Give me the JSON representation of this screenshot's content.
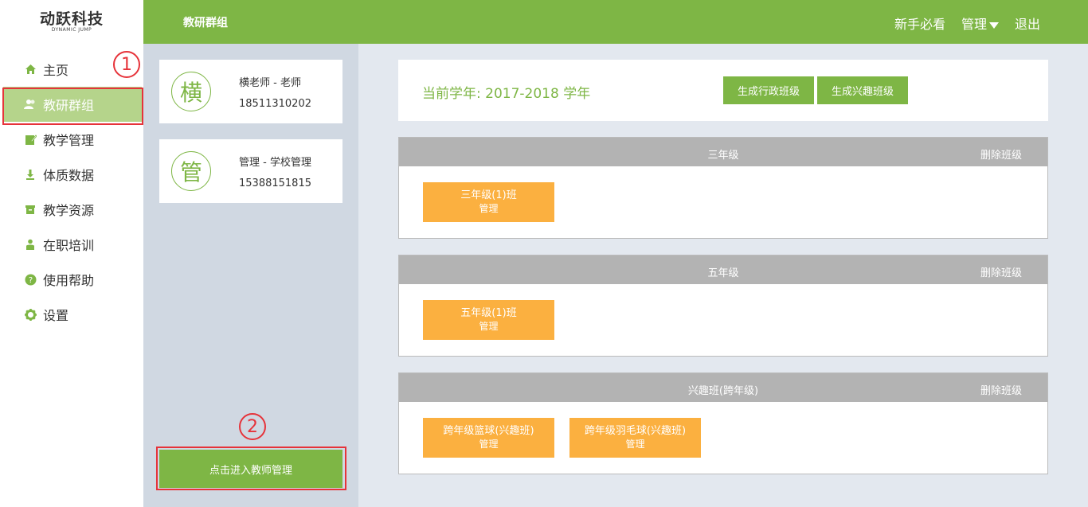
{
  "logo": {
    "main": "动跃科技",
    "sub": "DYNAMIC JUMP"
  },
  "sidebar": {
    "items": [
      {
        "label": "主页",
        "icon": "home-icon"
      },
      {
        "label": "教研群组",
        "icon": "users-icon"
      },
      {
        "label": "教学管理",
        "icon": "edit-icon"
      },
      {
        "label": "体质数据",
        "icon": "download-icon"
      },
      {
        "label": "教学资源",
        "icon": "box-icon"
      },
      {
        "label": "在职培训",
        "icon": "person-icon"
      },
      {
        "label": "使用帮助",
        "icon": "help-icon"
      },
      {
        "label": "设置",
        "icon": "gear-icon"
      }
    ]
  },
  "annotations": {
    "one": "1",
    "two": "2"
  },
  "header": {
    "title": "教研群组",
    "newbie": "新手必看",
    "manage": "管理",
    "logout": "退出"
  },
  "contacts": [
    {
      "avatar": "横",
      "name": "横老师 - 老师",
      "phone": "18511310202"
    },
    {
      "avatar": "管",
      "name": "管理 - 学校管理",
      "phone": "15388151815"
    }
  ],
  "enter_button": "点击进入教师管理",
  "year": {
    "label": "当前学年: 2017-2018 学年",
    "gen_admin": "生成行政班级",
    "gen_interest": "生成兴趣班级"
  },
  "grades": [
    {
      "name": "三年级",
      "delete": "删除班级",
      "classes": [
        {
          "name": "三年级(1)班",
          "manage": "管理"
        }
      ]
    },
    {
      "name": "五年级",
      "delete": "删除班级",
      "classes": [
        {
          "name": "五年级(1)班",
          "manage": "管理"
        }
      ]
    },
    {
      "name": "兴趣班(跨年级)",
      "delete": "删除班级",
      "classes": [
        {
          "name": "跨年级篮球(兴趣班)",
          "manage": "管理"
        },
        {
          "name": "跨年级羽毛球(兴趣班)",
          "manage": "管理"
        }
      ]
    }
  ],
  "colors": {
    "brand_green": "#7eb645",
    "class_orange": "#fbb040",
    "annotation_red": "#e6333a"
  }
}
